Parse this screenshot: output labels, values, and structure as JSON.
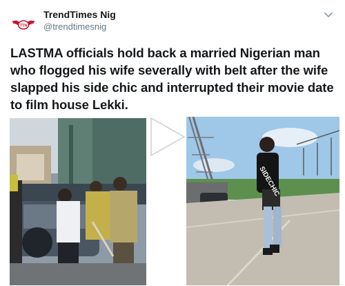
{
  "author": {
    "display_name": "TrendTimes Nig",
    "handle": "@trendtimesnig",
    "avatar_icon": "trendtimes-logo-icon",
    "logo_text": "TTN"
  },
  "menu": {
    "icon": "chevron-down-icon"
  },
  "tweet": {
    "text": "LASTMA officials hold back a married Nigerian man who flogged his wife severally with belt after the wife slapped his side chic and interrupted their movie date to film house Lekki."
  },
  "media": {
    "left_photo_icon": "crowd-photo",
    "right_photo_icon": "woman-photo",
    "shirt_text": "SIDECHIC",
    "play_icon": "play-icon"
  },
  "colors": {
    "text": "#14171a",
    "secondary": "#657786",
    "logo_red": "#c8102e"
  }
}
